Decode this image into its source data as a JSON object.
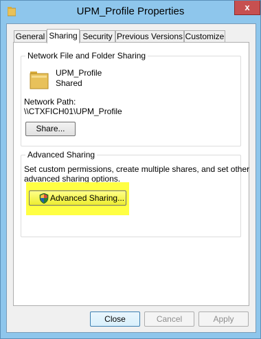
{
  "window": {
    "title": "UPM_Profile Properties",
    "close_glyph": "x"
  },
  "tabs": [
    {
      "label": "General",
      "active": false
    },
    {
      "label": "Sharing",
      "active": true
    },
    {
      "label": "Security",
      "active": false
    },
    {
      "label": "Previous Versions",
      "active": false
    },
    {
      "label": "Customize",
      "active": false
    }
  ],
  "network_sharing": {
    "group_title": "Network File and Folder Sharing",
    "folder_name": "UPM_Profile",
    "folder_status": "Shared",
    "network_path_label": "Network Path:",
    "network_path_value": "\\\\CTXFICH01\\UPM_Profile",
    "share_button": "Share..."
  },
  "advanced_sharing": {
    "group_title": "Advanced Sharing",
    "description_line1": "Set custom permissions, create multiple shares, and set other",
    "description_line2": "advanced sharing options.",
    "button_label": "Advanced Sharing...",
    "highlight_color": "#ffff22"
  },
  "footer": {
    "close_label": "Close",
    "cancel_label": "Cancel",
    "apply_label": "Apply"
  },
  "icons": {
    "title": "folder-icon",
    "folder": "folder-icon",
    "shield": "uac-shield-icon"
  }
}
